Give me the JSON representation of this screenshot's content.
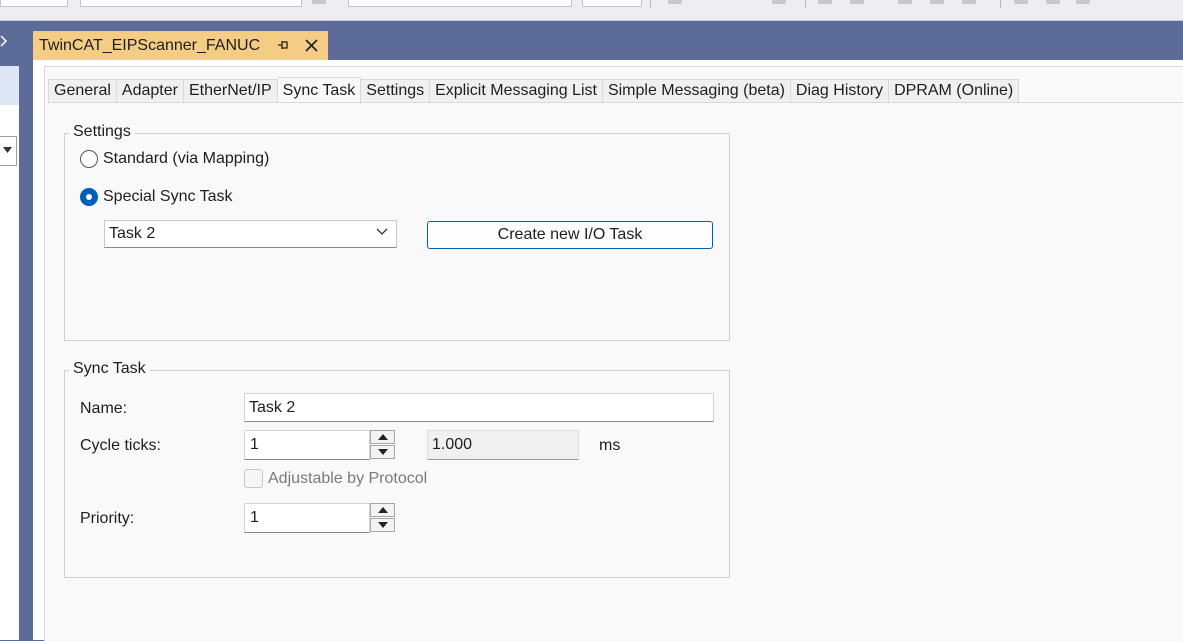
{
  "document_tab": {
    "title": "TwinCAT_EIPScanner_FANUC"
  },
  "tabs": [
    {
      "label": "General"
    },
    {
      "label": "Adapter"
    },
    {
      "label": "EtherNet/IP"
    },
    {
      "label": "Sync Task"
    },
    {
      "label": "Settings"
    },
    {
      "label": "Explicit Messaging List"
    },
    {
      "label": "Simple Messaging (beta)"
    },
    {
      "label": "Diag History"
    },
    {
      "label": "DPRAM (Online)"
    }
  ],
  "active_tab": "Sync Task",
  "settings_group": {
    "title": "Settings",
    "option_standard": "Standard (via Mapping)",
    "option_special": "Special Sync Task",
    "selected_option": "Special Sync Task",
    "task_select": "Task 2",
    "create_button": "Create new I/O Task"
  },
  "sync_task_group": {
    "title": "Sync Task",
    "name_label": "Name:",
    "name_value": "Task 2",
    "cycle_label": "Cycle ticks:",
    "cycle_value": "1",
    "cycle_time": "1.000",
    "cycle_unit": "ms",
    "adjustable_label": "Adjustable by Protocol",
    "adjustable_checked": false,
    "priority_label": "Priority:",
    "priority_value": "1"
  },
  "colors": {
    "frame": "#5d6b99",
    "active_doc_tab": "#f5cc84",
    "radio_accent": "#005fb8",
    "button_border": "#005fb8"
  }
}
